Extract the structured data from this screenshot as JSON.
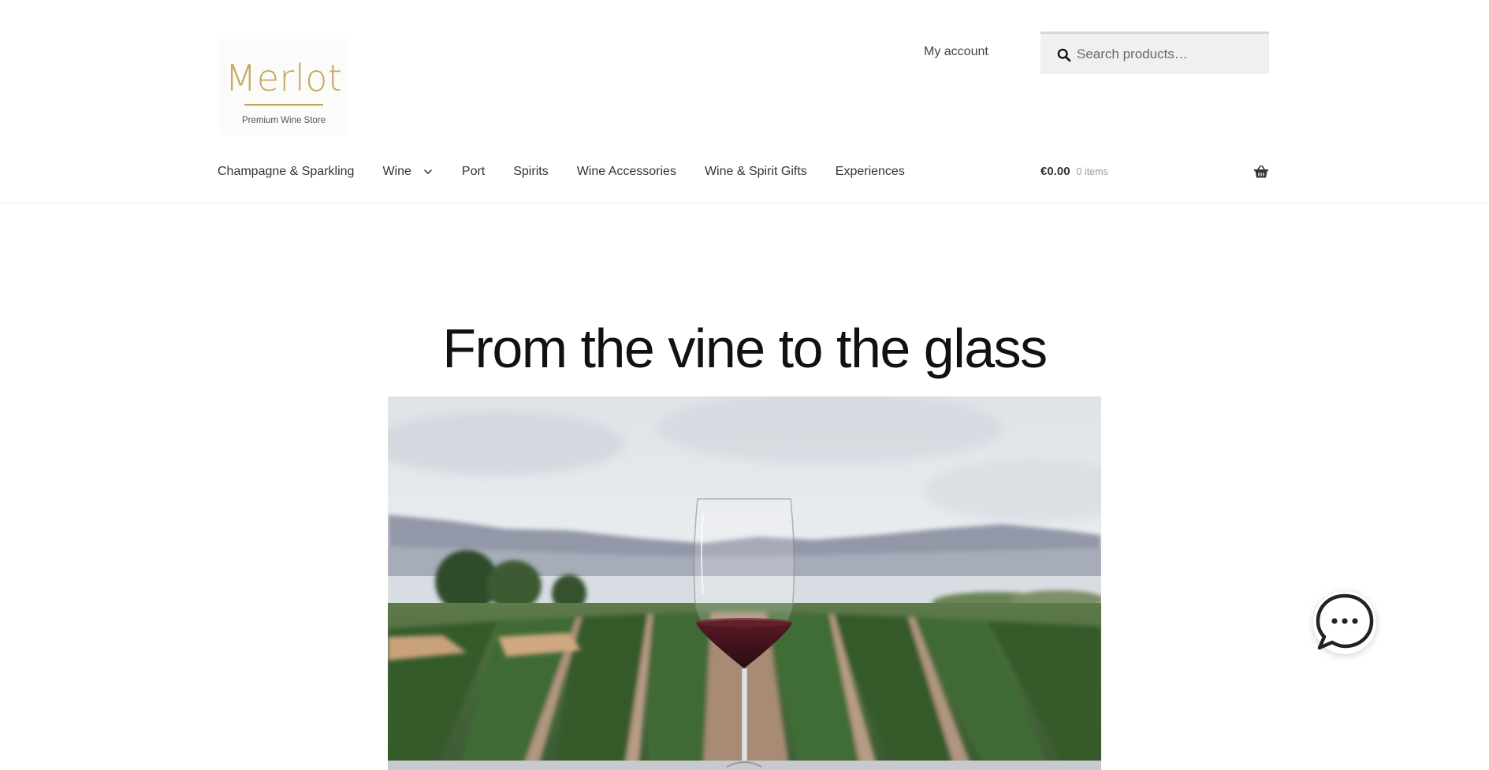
{
  "brand": {
    "name": "Merlot",
    "tagline": "Premium Wine Store",
    "color": "#c7a75f"
  },
  "header": {
    "account_link": "My account",
    "search": {
      "placeholder": "Search products…",
      "value": ""
    }
  },
  "nav": {
    "items": [
      {
        "label": "Champagne & Sparkling"
      },
      {
        "label": "Wine",
        "has_dropdown": true
      },
      {
        "label": "Port"
      },
      {
        "label": "Spirits"
      },
      {
        "label": "Wine Accessories"
      },
      {
        "label": "Wine & Spirit Gifts"
      },
      {
        "label": "Experiences"
      }
    ]
  },
  "cart": {
    "amount": "€0.00",
    "count": "0 items"
  },
  "hero": {
    "title": "From the vine to the glass",
    "image_icon": "wine-glass-vineyard-photo"
  },
  "chat": {
    "icon": "chat-bubble-icon"
  }
}
